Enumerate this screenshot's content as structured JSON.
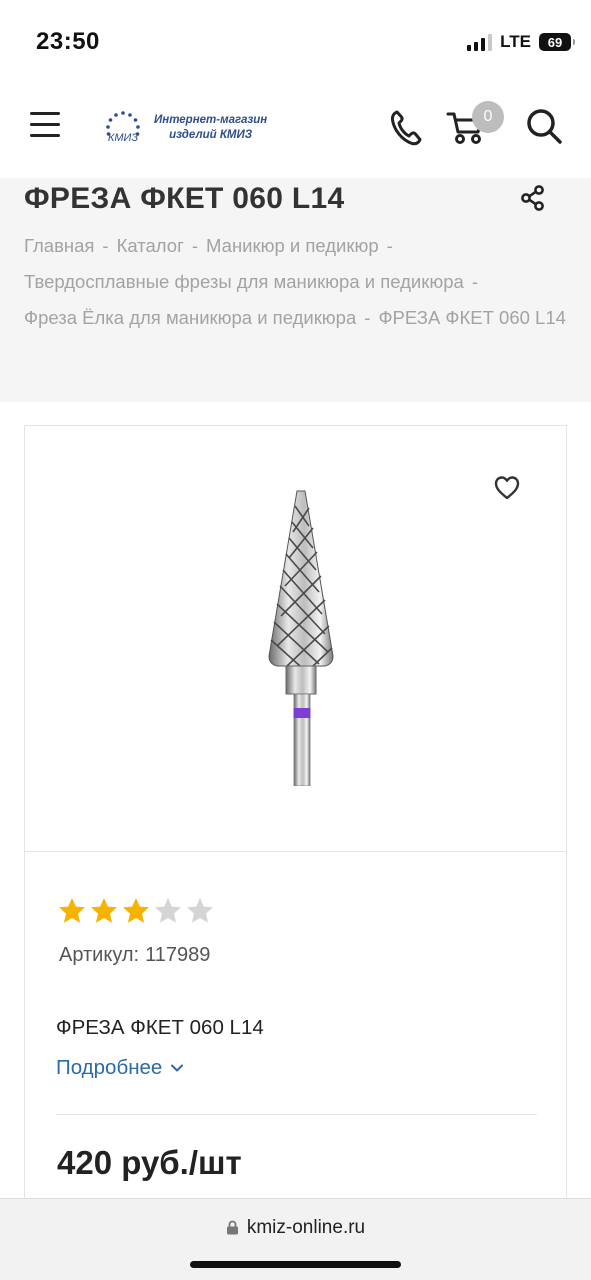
{
  "status_bar": {
    "time": "23:50",
    "network": "LTE",
    "battery": "69"
  },
  "header": {
    "logo_text_line1": "Интернет-магазин",
    "logo_text_line2": "изделий КМИЗ",
    "logo_mark_text": "КМИЗ",
    "cart_count": "0"
  },
  "page": {
    "title": "ФРЕЗА ФКЕТ 060 L14"
  },
  "breadcrumb": {
    "separator": "-",
    "items": [
      "Главная",
      "Каталог",
      "Маникюр и педикюр",
      "Твердосплавные фрезы для маникюра и педикюра",
      "Фреза Ёлка для маникюра и педикюра",
      "ФРЕЗА ФКЕТ 060 L14"
    ]
  },
  "product": {
    "rating": 3,
    "rating_max": 5,
    "star_color": "#f5b400",
    "star_empty_color": "#d5d5d5",
    "article_label": "Артикул:",
    "article_value": "117989",
    "short_name": "ФРЕЗА ФКЕТ 060 L14",
    "more_link": "Подробнее",
    "price": "420 руб./шт",
    "ring_color": "#7b3fd4"
  },
  "browser": {
    "url": "kmiz-online.ru"
  },
  "colors": {
    "accent_link": "#2d6aa8",
    "logo_blue": "#2e4e8f",
    "band_bg": "#f5f5f5"
  }
}
